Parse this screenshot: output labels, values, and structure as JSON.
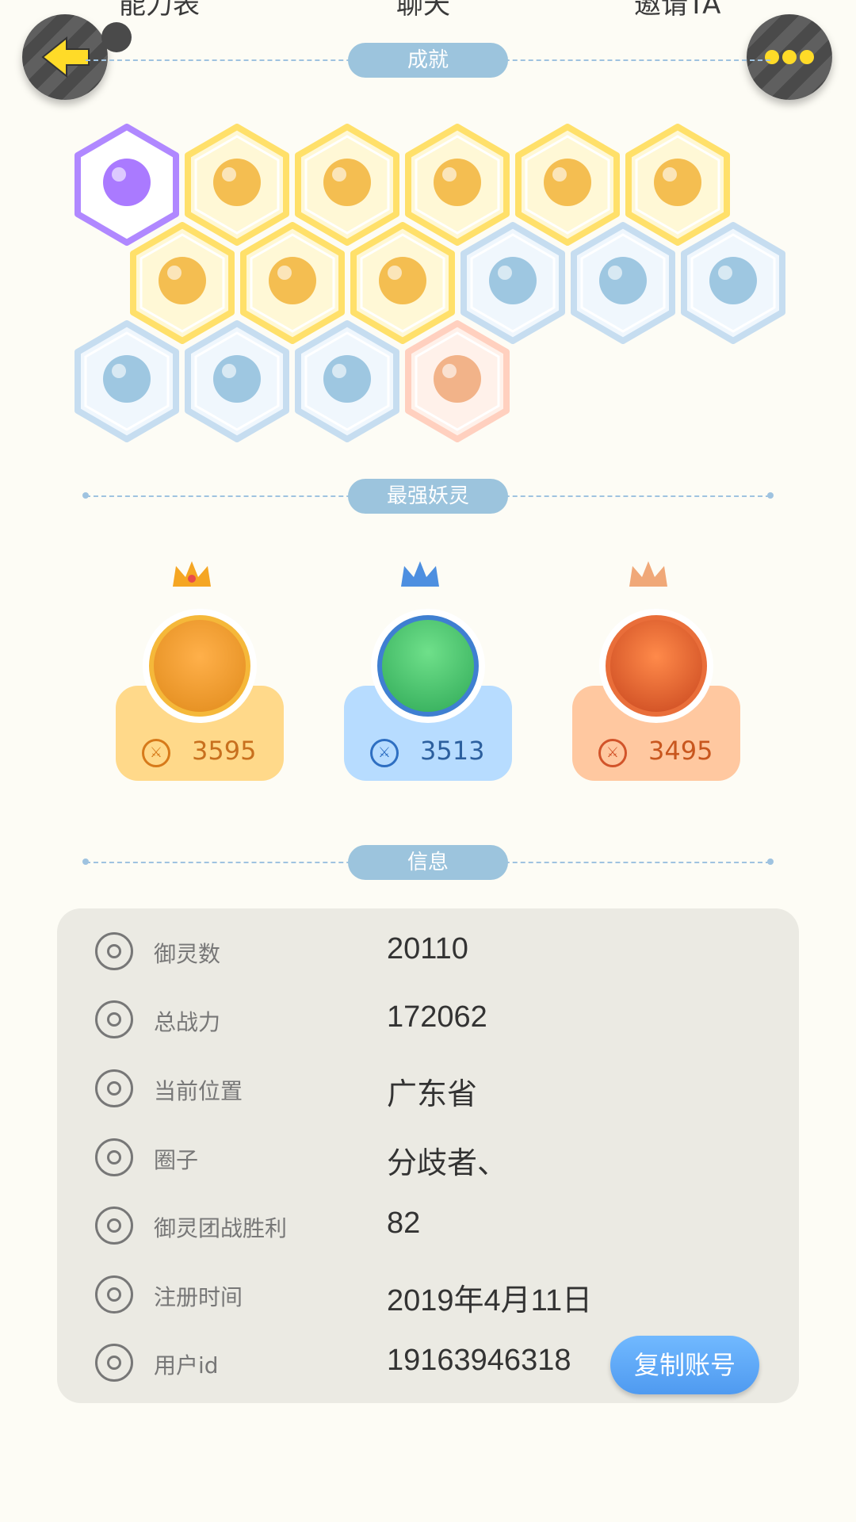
{
  "top_tabs": [
    "能力表",
    "聊天",
    "邀请TA"
  ],
  "sections": {
    "achievements": "成就",
    "strongest": "最强妖灵",
    "info": "信息"
  },
  "achievement_badges": [
    {
      "name": "purple-cat-badge-icon",
      "tier": "purple"
    },
    {
      "name": "sneaker-badge-icon",
      "tier": "gold"
    },
    {
      "name": "sun-target-badge-icon",
      "tier": "gold"
    },
    {
      "name": "golden-orb-badge-icon",
      "tier": "gold"
    },
    {
      "name": "yinyang-comet-badge-icon",
      "tier": "gold"
    },
    {
      "name": "fox-balloon-badge-icon",
      "tier": "gold"
    },
    {
      "name": "yinyang-book-badge-icon",
      "tier": "gold"
    },
    {
      "name": "dragon-badge-icon",
      "tier": "gold"
    },
    {
      "name": "fox-open-book-badge-icon",
      "tier": "gold"
    },
    {
      "name": "moon-badge-icon",
      "tier": "blue"
    },
    {
      "name": "crystal-badge-icon",
      "tier": "blue"
    },
    {
      "name": "spirit-statue-badge-icon",
      "tier": "blue"
    },
    {
      "name": "cart-cat-badge-icon",
      "tier": "blue"
    },
    {
      "name": "shield-badge-icon",
      "tier": "blue"
    },
    {
      "name": "cat-silhouette-badge-icon",
      "tier": "blue"
    },
    {
      "name": "demon-statue-badge-icon",
      "tier": "orange"
    }
  ],
  "champions": [
    {
      "power": "3595",
      "theme": "gold"
    },
    {
      "power": "3513",
      "theme": "blue"
    },
    {
      "power": "3495",
      "theme": "orange"
    }
  ],
  "info": [
    {
      "label": "御灵数",
      "value": "20110",
      "icon": "spirit-count-icon"
    },
    {
      "label": "总战力",
      "value": "172062",
      "icon": "sword-power-icon"
    },
    {
      "label": "当前位置",
      "value": "广东省",
      "icon": "location-pin-icon"
    },
    {
      "label": "圈子",
      "value": "分歧者、",
      "icon": "circle-ring-icon"
    },
    {
      "label": "御灵团战胜利",
      "value": "82",
      "icon": "victory-sword-icon"
    },
    {
      "label": "注册时间",
      "value": "2019年4月11日",
      "icon": "clock-icon"
    },
    {
      "label": "用户id",
      "value": "19163946318",
      "icon": "id-card-icon"
    }
  ],
  "copy_button": "复制账号",
  "colors": {
    "background": "#fdfcf5",
    "pill": "#9cc4dd",
    "gold": "#ffd98a",
    "blue": "#b7dcff",
    "orange": "#ffc8a0",
    "panel": "#ebeae3",
    "copy_button": "#5aa8f8"
  }
}
